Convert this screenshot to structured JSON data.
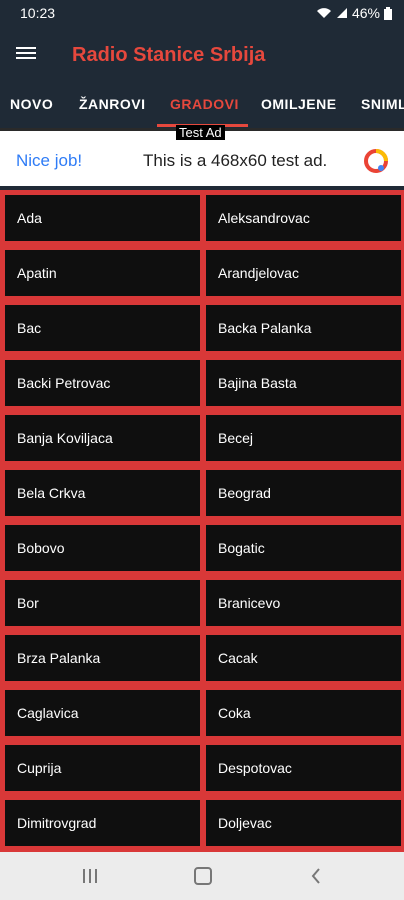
{
  "status": {
    "time": "10:23",
    "battery": "46%"
  },
  "app": {
    "title": "Radio Stanice Srbija"
  },
  "tabs": [
    {
      "label": "NOVO"
    },
    {
      "label": "ŽANROVI"
    },
    {
      "label": "GRADOVI",
      "active": true
    },
    {
      "label": "OMILJENE"
    },
    {
      "label": "SNIMLJENO"
    }
  ],
  "ad": {
    "tag": "Test Ad",
    "nice": "Nice job!",
    "text": "This is a 468x60 test ad."
  },
  "cities": [
    "Ada",
    "Aleksandrovac",
    "Apatin",
    "Arandjelovac",
    "Bac",
    "Backa Palanka",
    "Backi Petrovac",
    "Bajina Basta",
    "Banja Koviljaca",
    "Becej",
    "Bela Crkva",
    "Beograd",
    "Bobovo",
    "Bogatic",
    "Bor",
    "Branicevo",
    "Brza Palanka",
    "Cacak",
    "Caglavica",
    "Coka",
    "Cuprija",
    "Despotovac",
    "Dimitrovgrad",
    "Doljevac"
  ],
  "colors": {
    "accent": "#e6483d",
    "background": "#1f2a36",
    "grid": "#d93838",
    "cell": "#0f0f0f"
  },
  "icons": [
    "menu-icon",
    "wifi-icon",
    "signal-icon",
    "battery-icon",
    "recent-apps-icon",
    "home-icon",
    "back-icon"
  ]
}
